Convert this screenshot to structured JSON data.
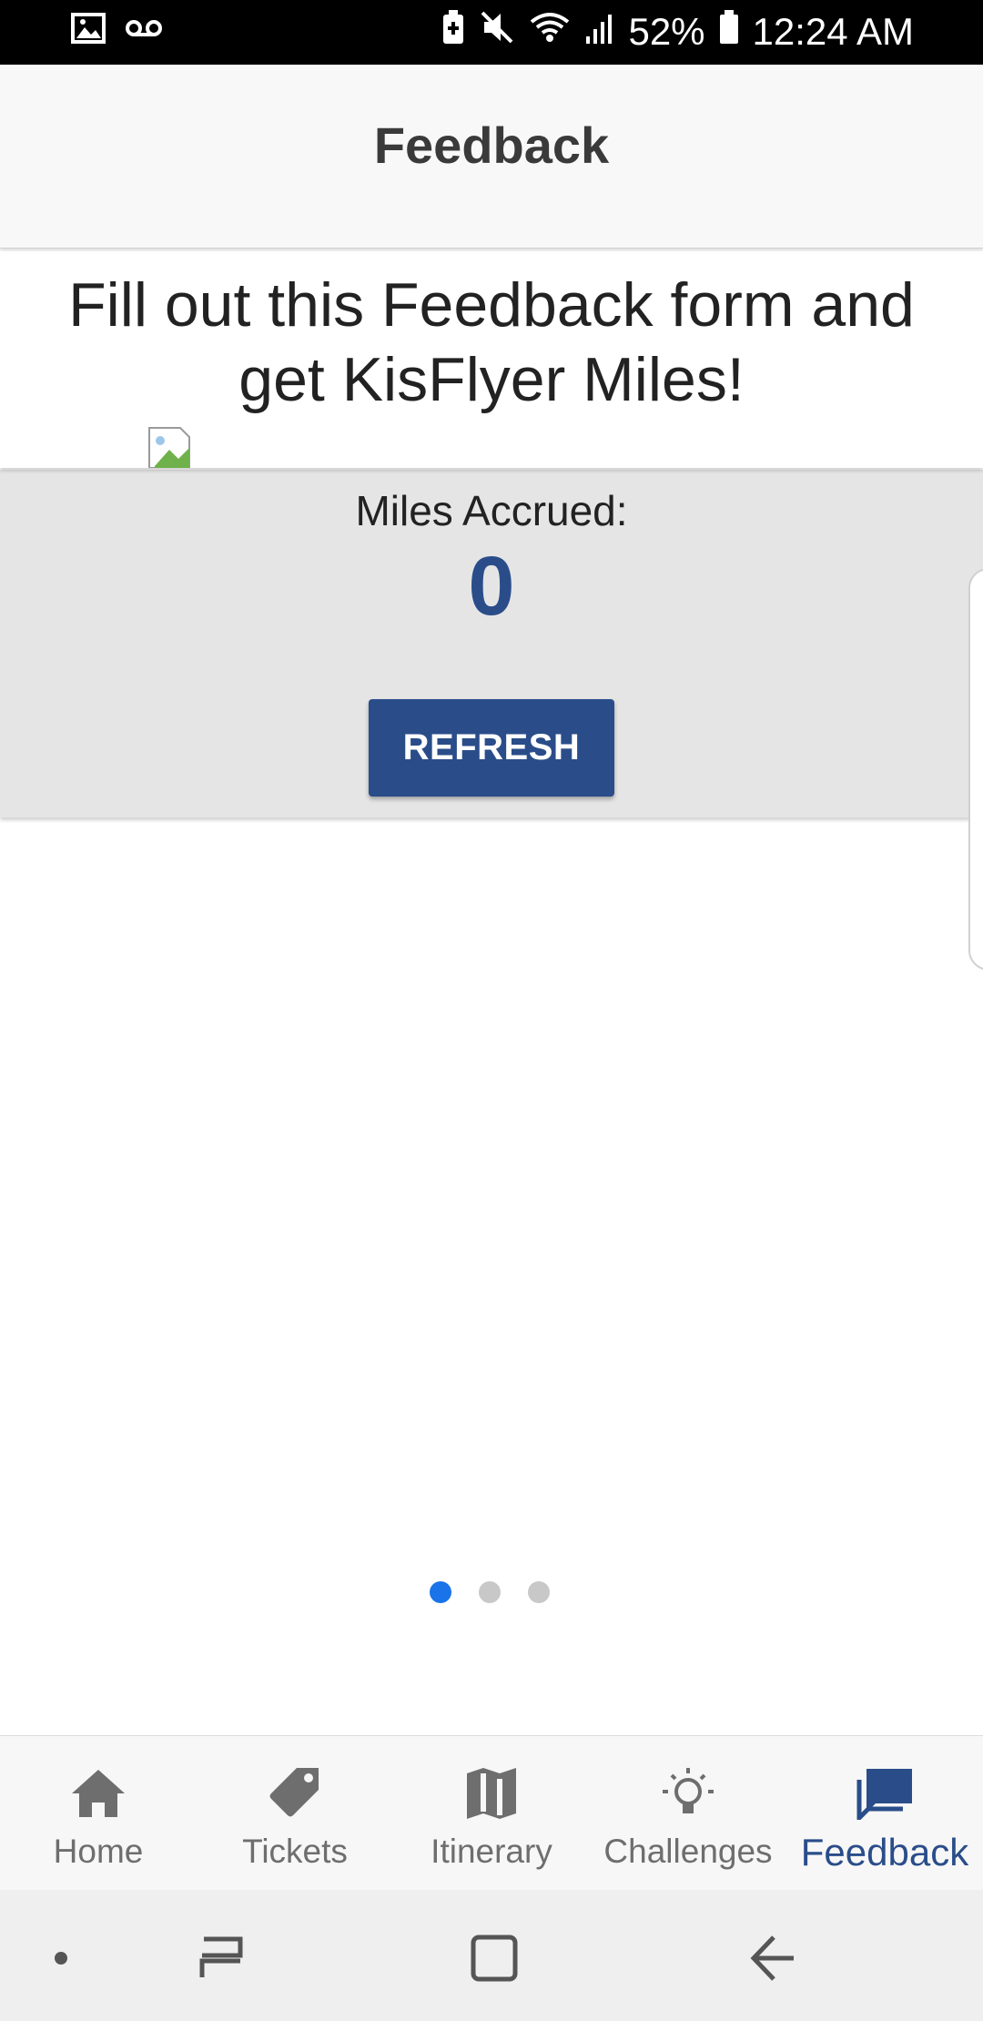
{
  "status_bar": {
    "battery_percent": "52%",
    "time": "12:24 AM",
    "icons": [
      "gallery-icon",
      "voicemail-icon",
      "battery-saver-icon",
      "mute-icon",
      "wifi-icon",
      "signal-icon",
      "battery-icon"
    ]
  },
  "app_bar": {
    "title": "Feedback"
  },
  "headline": {
    "line1": "Fill out this Feedback form and",
    "line2": "get KisFlyer Miles!"
  },
  "miles": {
    "label": "Miles Accrued:",
    "value": "0",
    "refresh_label": "REFRESH"
  },
  "pager": {
    "count": 3,
    "active_index": 0
  },
  "bottom_nav": {
    "items": [
      {
        "label": "Home",
        "icon": "home-icon"
      },
      {
        "label": "Tickets",
        "icon": "tag-icon"
      },
      {
        "label": "Itinerary",
        "icon": "map-icon"
      },
      {
        "label": "Challenges",
        "icon": "lightbulb-icon"
      },
      {
        "label": "Feedback",
        "icon": "chat-icon",
        "active": true
      }
    ]
  },
  "colors": {
    "accent": "#2a4d8a",
    "pager_active": "#1a73e8",
    "miles_background": "#e5e5e5"
  }
}
